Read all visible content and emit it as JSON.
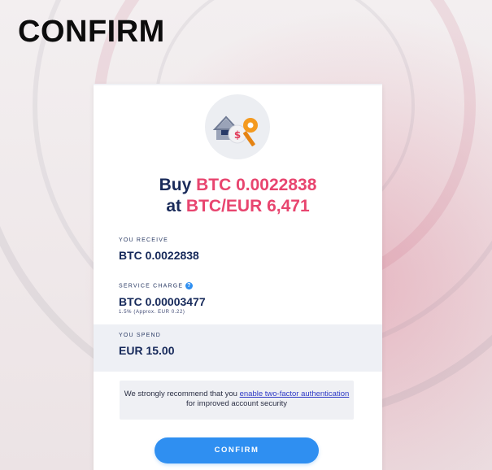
{
  "page": {
    "heading": "CONFIRM"
  },
  "order": {
    "title_verb": "Buy",
    "title_amount": "BTC 0.0022838",
    "title_at": "at",
    "title_rate": "BTC/EUR 6,471"
  },
  "receive": {
    "label": "YOU RECEIVE",
    "value": "BTC 0.0022838"
  },
  "service_charge": {
    "label": "SERVICE CHARGE",
    "value": "BTC 0.00003477",
    "detail": "1.5% (Approx. EUR 0.22)",
    "help_icon": "question-circle-icon"
  },
  "spend": {
    "label": "YOU SPEND",
    "value": "EUR 15.00"
  },
  "notice": {
    "text_before": "We strongly recommend that you ",
    "link_text": "enable two-factor authentication",
    "text_after": " for improved account security"
  },
  "actions": {
    "confirm_label": "CONFIRM"
  },
  "colors": {
    "accent_pink": "#e8456f",
    "navy": "#16295a",
    "button_blue": "#2f8ff1"
  },
  "icons": {
    "hero": "house-money-key-icon"
  }
}
